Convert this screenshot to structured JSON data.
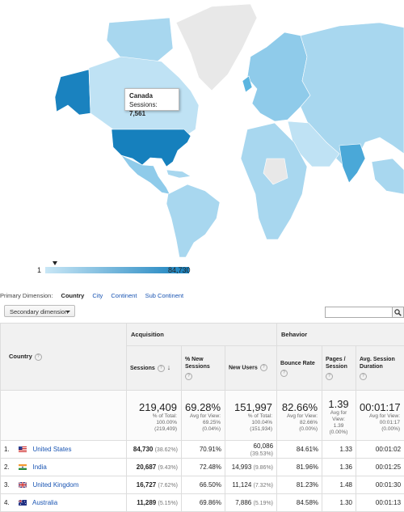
{
  "map": {
    "tooltip": {
      "country": "Canada",
      "metric_label": "Sessions:",
      "metric_value": "7,561"
    },
    "legend": {
      "min": "1",
      "max": "84,730"
    },
    "colors": {
      "ocean": "#ffffff",
      "no_data": "#e8e8e8",
      "low": "#a8d7ef",
      "mid": "#5bb5e0",
      "high": "#1680bd"
    }
  },
  "primary_dimension": {
    "label": "Primary Dimension:",
    "options": [
      {
        "label": "Country",
        "selected": true
      },
      {
        "label": "City",
        "selected": false
      },
      {
        "label": "Continent",
        "selected": false
      },
      {
        "label": "Sub Continent",
        "selected": false
      }
    ]
  },
  "secondary_dimension": {
    "label": "Secondary dimension"
  },
  "search": {
    "value": "",
    "icon": "search-icon"
  },
  "table": {
    "group_acquisition": "Acquisition",
    "group_behavior": "Behavior",
    "country_header": "Country",
    "columns": {
      "sessions": "Sessions",
      "new_sessions": "% New Sessions",
      "new_users": "New Users",
      "bounce_rate": "Bounce Rate",
      "pages_session": "Pages / Session",
      "avg_duration": "Avg. Session Duration"
    },
    "totals": {
      "sessions": {
        "value": "219,409",
        "sub1": "% of Total:",
        "sub2": "100.00%",
        "sub3": "(219,409)"
      },
      "new_sessions": {
        "value": "69.28%",
        "sub1": "Avg for View:",
        "sub2": "69.25%",
        "sub3": "(0.04%)"
      },
      "new_users": {
        "value": "151,997",
        "sub1": "% of Total:",
        "sub2": "100.04%",
        "sub3": "(151,934)"
      },
      "bounce_rate": {
        "value": "82.66%",
        "sub1": "Avg for View:",
        "sub2": "82.66%",
        "sub3": "(0.00%)"
      },
      "pages_session": {
        "value": "1.39",
        "sub1": "Avg for View:",
        "sub2": "1.39",
        "sub3": "(0.00%)"
      },
      "avg_duration": {
        "value": "00:01:17",
        "sub1": "Avg for View:",
        "sub2": "00:01:17",
        "sub3": "(0.00%)"
      }
    },
    "rows": [
      {
        "idx": "1.",
        "country": "United States",
        "flag": "us-flag-icon",
        "sessions": "84,730",
        "sessions_pct": "(38.62%)",
        "new_sessions": "70.91%",
        "new_users": "60,086",
        "new_users_pct": "(39.53%)",
        "bounce_rate": "84.61%",
        "pages": "1.33",
        "duration": "00:01:02"
      },
      {
        "idx": "2.",
        "country": "India",
        "flag": "in-flag-icon",
        "sessions": "20,687",
        "sessions_pct": "(9.43%)",
        "new_sessions": "72.48%",
        "new_users": "14,993",
        "new_users_pct": "(9.86%)",
        "bounce_rate": "81.96%",
        "pages": "1.36",
        "duration": "00:01:25"
      },
      {
        "idx": "3.",
        "country": "United Kingdom",
        "flag": "uk-flag-icon",
        "sessions": "16,727",
        "sessions_pct": "(7.62%)",
        "new_sessions": "66.50%",
        "new_users": "11,124",
        "new_users_pct": "(7.32%)",
        "bounce_rate": "81.23%",
        "pages": "1.48",
        "duration": "00:01:30"
      },
      {
        "idx": "4.",
        "country": "Australia",
        "flag": "au-flag-icon",
        "sessions": "11,289",
        "sessions_pct": "(5.15%)",
        "new_sessions": "69.86%",
        "new_users": "7,886",
        "new_users_pct": "(5.19%)",
        "bounce_rate": "84.58%",
        "pages": "1.30",
        "duration": "00:01:13"
      }
    ]
  }
}
